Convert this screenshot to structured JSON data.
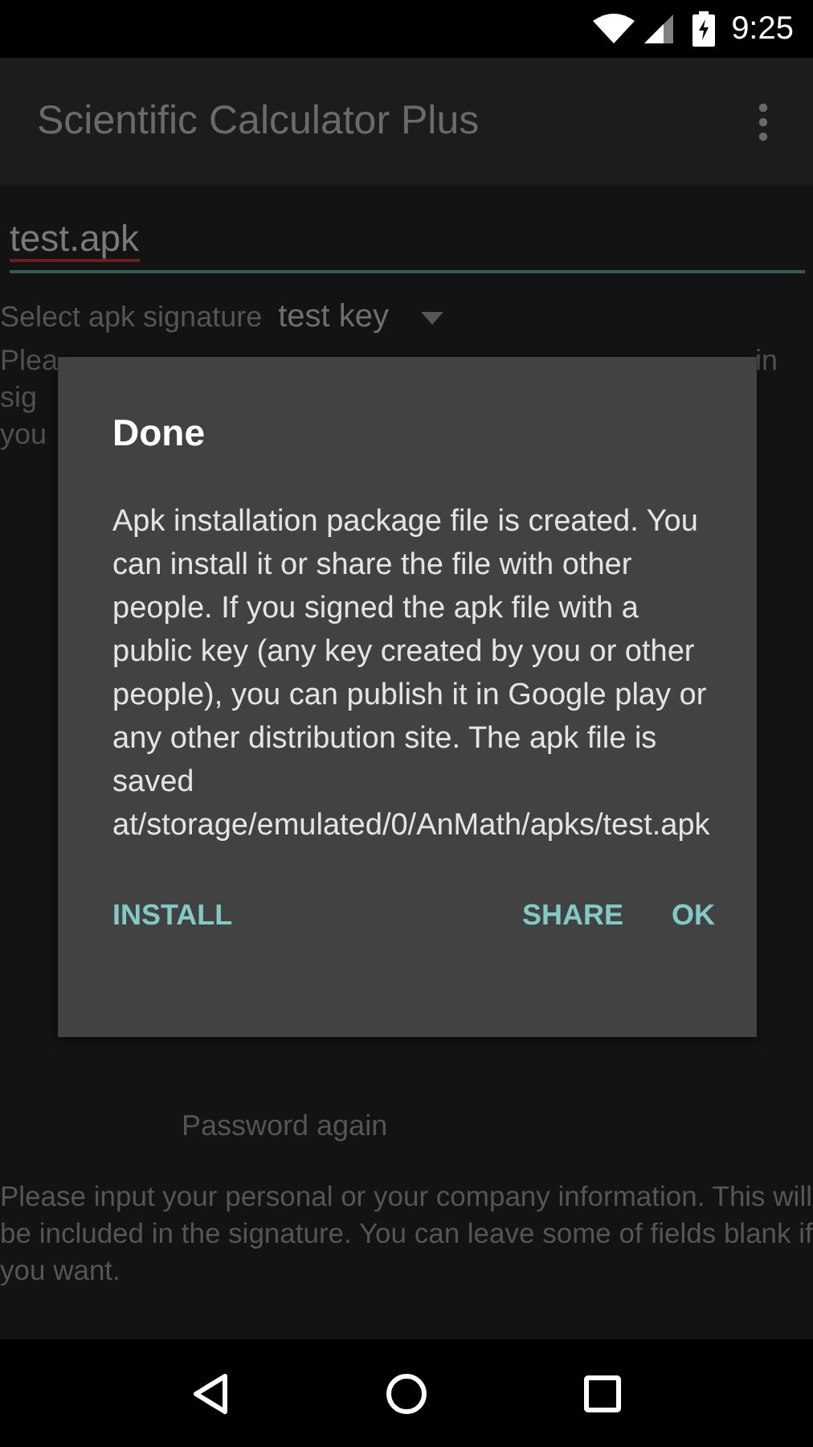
{
  "status_bar": {
    "time": "9:25"
  },
  "app_bar": {
    "title": "Scientific Calculator Plus"
  },
  "file_name_field": {
    "value": "test.apk"
  },
  "signature": {
    "label": "Select apk signature",
    "value": "test key"
  },
  "hint_fragments": {
    "left": [
      "Plea",
      "sig",
      "you"
    ],
    "right": [
      "in"
    ]
  },
  "password_again_label": "Password again",
  "info_text": "Please input your personal or your company information. This will be included in the signature. You can leave some of fields blank if you want.",
  "dialog": {
    "title": "Done",
    "message": "Apk installation package file is created. You can install it or share the file with other people. If you signed the apk file with a public key (any key created by you or other people), you can publish it in Google play or any other distribution site. The apk file is saved at/storage/emulated/0/AnMath/apks/test.apk",
    "buttons": [
      {
        "label": "INSTALL",
        "kind": "neutral"
      },
      {
        "label": "SHARE",
        "kind": "negative"
      },
      {
        "label": "OK",
        "kind": "positive"
      }
    ]
  }
}
